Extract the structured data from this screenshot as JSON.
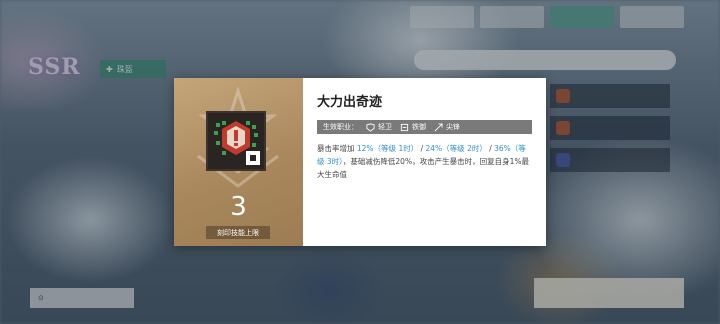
{
  "skill": {
    "title": "大力出奇迹",
    "level_value": "3",
    "level_caption": "刻印技能上限",
    "classes_label": "生效职业：",
    "classes": [
      "轻卫",
      "铁御",
      "尖锋"
    ],
    "description": [
      {
        "text": "暴击率增加 ",
        "highlight": false
      },
      {
        "text": "12%（等级 1时）",
        "highlight": true
      },
      {
        "text": " / ",
        "highlight": false
      },
      {
        "text": "24%（等级 2时）",
        "highlight": true
      },
      {
        "text": " / ",
        "highlight": false
      },
      {
        "text": "36%（等级 3时）",
        "highlight": true
      },
      {
        "text": "，基础减伤降低20%，攻击产生暴击时，回复自身1%最大生命值",
        "highlight": false
      }
    ]
  },
  "background": {
    "rarity_text": "SSR",
    "tag_label": "珠盔"
  },
  "colors": {
    "highlight": "#2f8fd0",
    "dialog_left": "#b08f63",
    "class_bar": "#7a7a7a"
  }
}
